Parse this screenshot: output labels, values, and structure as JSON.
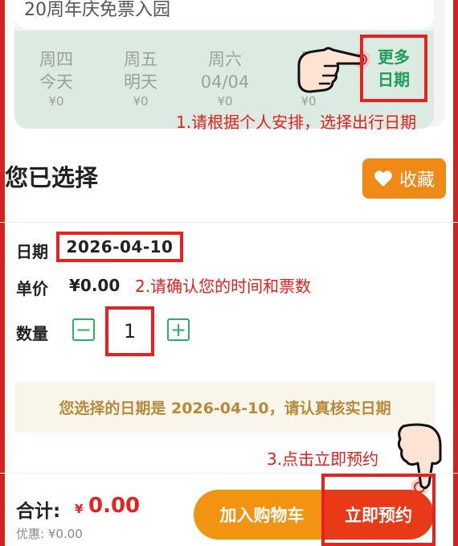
{
  "ticket": {
    "name": "20周年庆免票入园"
  },
  "dates": [
    {
      "weekday": "周四",
      "label": "今天",
      "price": "¥0"
    },
    {
      "weekday": "周五",
      "label": "明天",
      "price": "¥0"
    },
    {
      "weekday": "周六",
      "label": "04/04",
      "price": "¥0"
    },
    {
      "weekday": "周",
      "label": "0",
      "price": "¥0"
    }
  ],
  "more_dates": {
    "line1": "更多",
    "line2": "日期"
  },
  "annotations": {
    "step1": "1.请根据个人安排，选择出行日期",
    "step2": "2.请确认您的时间和票数",
    "step3": "3.点击立即预约"
  },
  "selection": {
    "title": "您已选择",
    "favorite_label": "收藏",
    "date_label": "日期",
    "date_value": "2026-04-10",
    "price_label": "单价",
    "price_value": "¥0.00",
    "qty_label": "数量",
    "qty_value": "1",
    "minus": "−",
    "plus": "+"
  },
  "notice": "您选择的日期是 2026-04-10，请认真核实日期",
  "footer": {
    "total_label": "合计:",
    "currency": "¥",
    "total_value": "0.00",
    "discount": "优惠: ¥0.00",
    "cart_button": "加入购物车",
    "book_button": "立即预约"
  },
  "colors": {
    "accent_red": "#e8201f",
    "green": "#2bb15f",
    "orange": "#f39312",
    "book_red": "#e83a17"
  },
  "icons": [
    "heart-icon",
    "minus-icon",
    "plus-icon",
    "pointing-hand-icon"
  ]
}
